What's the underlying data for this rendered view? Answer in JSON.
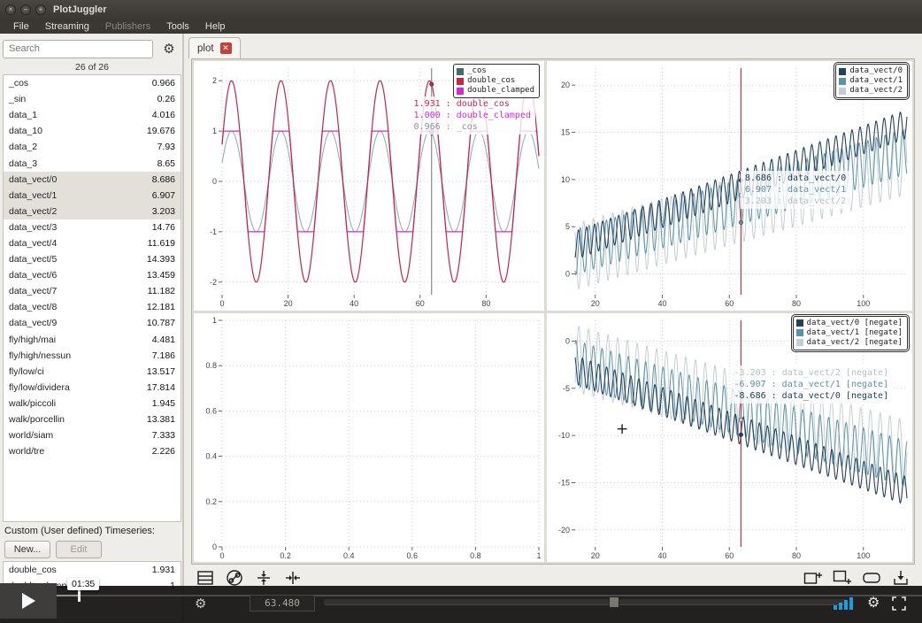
{
  "window": {
    "title": "PlotJuggler",
    "controls": [
      {
        "name": "close",
        "glyph": "×"
      },
      {
        "name": "minimize",
        "glyph": "–"
      },
      {
        "name": "maximize",
        "glyph": "+"
      }
    ]
  },
  "menubar": {
    "items": [
      {
        "label": "File",
        "enabled": true
      },
      {
        "label": "Streaming",
        "enabled": true
      },
      {
        "label": "Publishers",
        "enabled": false
      },
      {
        "label": "Tools",
        "enabled": true
      },
      {
        "label": "Help",
        "enabled": true
      }
    ]
  },
  "sidebar": {
    "search_placeholder": "Search",
    "count_text": "26 of 26",
    "series": [
      {
        "name": "_cos",
        "value": "0.966",
        "selected": false
      },
      {
        "name": "_sin",
        "value": "0.26",
        "selected": false
      },
      {
        "name": "data_1",
        "value": "4.016",
        "selected": false
      },
      {
        "name": "data_10",
        "value": "19.676",
        "selected": false
      },
      {
        "name": "data_2",
        "value": "7.93",
        "selected": false
      },
      {
        "name": "data_3",
        "value": "8.65",
        "selected": false
      },
      {
        "name": "data_vect/0",
        "value": "8.686",
        "selected": true
      },
      {
        "name": "data_vect/1",
        "value": "6.907",
        "selected": true
      },
      {
        "name": "data_vect/2",
        "value": "3.203",
        "selected": true
      },
      {
        "name": "data_vect/3",
        "value": "14.76",
        "selected": false
      },
      {
        "name": "data_vect/4",
        "value": "11.619",
        "selected": false
      },
      {
        "name": "data_vect/5",
        "value": "14.393",
        "selected": false
      },
      {
        "name": "data_vect/6",
        "value": "13.459",
        "selected": false
      },
      {
        "name": "data_vect/7",
        "value": "11.182",
        "selected": false
      },
      {
        "name": "data_vect/8",
        "value": "12.181",
        "selected": false
      },
      {
        "name": "data_vect/9",
        "value": "10.787",
        "selected": false
      },
      {
        "name": "fly/high/mai",
        "value": "4.481",
        "selected": false
      },
      {
        "name": "fly/high/nessun",
        "value": "7.186",
        "selected": false
      },
      {
        "name": "fly/low/ci",
        "value": "13.517",
        "selected": false
      },
      {
        "name": "fly/low/dividera",
        "value": "17.814",
        "selected": false
      },
      {
        "name": "walk/piccoli",
        "value": "1.945",
        "selected": false
      },
      {
        "name": "walk/porcellin",
        "value": "13.381",
        "selected": false
      },
      {
        "name": "world/siam",
        "value": "7.333",
        "selected": false
      },
      {
        "name": "world/tre",
        "value": "2.226",
        "selected": false
      }
    ],
    "custom_section_label": "Custom (User defined) Timeseries:",
    "new_button_label": "New...",
    "edit_button_label": "Edit",
    "custom_series": [
      {
        "name": "double_cos",
        "value": "1.931"
      },
      {
        "name": "double_clamped",
        "value": "1"
      }
    ]
  },
  "main": {
    "tab": {
      "label": "plot"
    },
    "toolbar_left_icons": [
      "grid-layout",
      "link-plots",
      "align-vertical",
      "align-horizontal"
    ],
    "toolbar_right_icons": [
      "add-column",
      "add-row",
      "zoom-area",
      "import-data"
    ]
  },
  "bottombar": {
    "current_time": "63.480"
  },
  "player": {
    "elapsed": "01:35"
  },
  "chart_data": [
    {
      "id": "tl",
      "type": "line",
      "x_range": [
        0,
        96
      ],
      "x_ticks": [
        0,
        20,
        40,
        60,
        80
      ],
      "y_range": [
        -2.25,
        2.25
      ],
      "y_ticks": [
        -2,
        -1,
        0,
        1,
        2
      ],
      "legend": [
        {
          "label": "_cos",
          "color": "#3f6f6a"
        },
        {
          "label": "double_cos",
          "color": "#c2274b"
        },
        {
          "label": "double_clamped",
          "color": "#d42ad4"
        }
      ],
      "series": [
        {
          "name": "_cos",
          "color": "#8fa8ab",
          "fn": "cos",
          "amp": 1,
          "period": 15,
          "phase": 2.855,
          "width": 1
        },
        {
          "name": "double_clamped",
          "color": "#d42ad4",
          "fn": "cos",
          "amp": 2,
          "period": 15,
          "phase": 2.855,
          "clamp": 1,
          "width": 1.2
        },
        {
          "name": "double_cos",
          "color": "#c2274b",
          "fn": "cos",
          "amp": 2,
          "period": 15,
          "phase": 2.855,
          "width": 1.2
        }
      ],
      "tracker": {
        "x": 63.48,
        "color": "#8a8a8a",
        "labels": [
          {
            "text": "1.931 : double_cos",
            "color": "#c2274b"
          },
          {
            "text": "1.000 : double_clamped",
            "color": "#d42ad4"
          },
          {
            "text": "0.966 : _cos",
            "color": "#8a9093"
          }
        ]
      }
    },
    {
      "id": "tr",
      "type": "line",
      "x_range": [
        14,
        113
      ],
      "x_ticks": [
        20,
        40,
        60,
        80,
        100
      ],
      "y_range": [
        -2.2,
        21.8
      ],
      "y_ticks": [
        0,
        5,
        10,
        15,
        20
      ],
      "legend": [
        {
          "label": "data_vect/0",
          "color": "#24415e"
        },
        {
          "label": "data_vect/1",
          "color": "#5b93a6"
        },
        {
          "label": "data_vect/2",
          "color": "#c4ced2"
        }
      ],
      "series": [
        {
          "name": "data_vect/2",
          "color": "#c4ced2",
          "fn": "trend",
          "intercept": 0.4,
          "slope": 0.102,
          "amp": 3.5,
          "period": 2.9,
          "phase": 3.4,
          "width": 1
        },
        {
          "name": "data_vect/1",
          "color": "#5b93a6",
          "fn": "trend",
          "intercept": 0.8,
          "slope": 0.108,
          "amp": 2.4,
          "period": 2.6,
          "phase": 1.7,
          "width": 1
        },
        {
          "name": "data_vect/0",
          "color": "#24415e",
          "fn": "trend",
          "intercept": 1.2,
          "slope": 0.13,
          "amp": 1.5,
          "period": 2.4,
          "phase": 0,
          "width": 1.1
        }
      ],
      "tracker": {
        "x": 63.48,
        "color": "#cc3347",
        "labels": [
          {
            "text": "8.686 : data_vect/0",
            "color": "#24415e"
          },
          {
            "text": "6.907 : data_vect/1",
            "color": "#5b93a6"
          },
          {
            "text": "3.203 : data_vect/2",
            "color": "#b4bfc4"
          }
        ]
      }
    },
    {
      "id": "bl",
      "type": "line",
      "x_range": [
        0,
        1
      ],
      "x_ticks": [
        0,
        0.2,
        0.4,
        0.6,
        0.8,
        1
      ],
      "y_range": [
        0,
        1
      ],
      "y_ticks": [
        0,
        0.2,
        0.4,
        0.6,
        0.8,
        1
      ],
      "legend": [],
      "series": []
    },
    {
      "id": "br",
      "type": "line",
      "x_range": [
        14,
        113
      ],
      "x_ticks": [
        20,
        40,
        60,
        80,
        100
      ],
      "y_range": [
        -21.8,
        2.2
      ],
      "y_ticks": [
        0,
        -5,
        -10,
        -15,
        -20
      ],
      "legend": [
        {
          "label": "data_vect/0 [negate]",
          "color": "#24415e"
        },
        {
          "label": "data_vect/1 [negate]",
          "color": "#5b93a6"
        },
        {
          "label": "data_vect/2 [negate]",
          "color": "#c4ced2"
        }
      ],
      "series": [
        {
          "name": "data_vect/2 [negate]",
          "color": "#c4ced2",
          "fn": "trend",
          "intercept": 0.4,
          "slope": 0.102,
          "amp": 3.5,
          "period": 2.9,
          "phase": 3.4,
          "scale": -1,
          "width": 1
        },
        {
          "name": "data_vect/1 [negate]",
          "color": "#5b93a6",
          "fn": "trend",
          "intercept": 0.8,
          "slope": 0.108,
          "amp": 2.4,
          "period": 2.6,
          "phase": 1.7,
          "scale": -1,
          "width": 1
        },
        {
          "name": "data_vect/0 [negate]",
          "color": "#24415e",
          "fn": "trend",
          "intercept": 1.2,
          "slope": 0.13,
          "amp": 1.5,
          "period": 2.4,
          "phase": 0,
          "scale": -1,
          "width": 1.1
        }
      ],
      "tracker": {
        "x": 63.48,
        "color": "#cc3347",
        "labels": [
          {
            "text": "-3.203 : data_vect/2 [negate]",
            "color": "#b4bfc4"
          },
          {
            "text": "-6.907 : data_vect/1 [negate]",
            "color": "#5b93a6"
          },
          {
            "text": "-8.686 : data_vect/0 [negate]",
            "color": "#24415e"
          }
        ]
      }
    }
  ]
}
